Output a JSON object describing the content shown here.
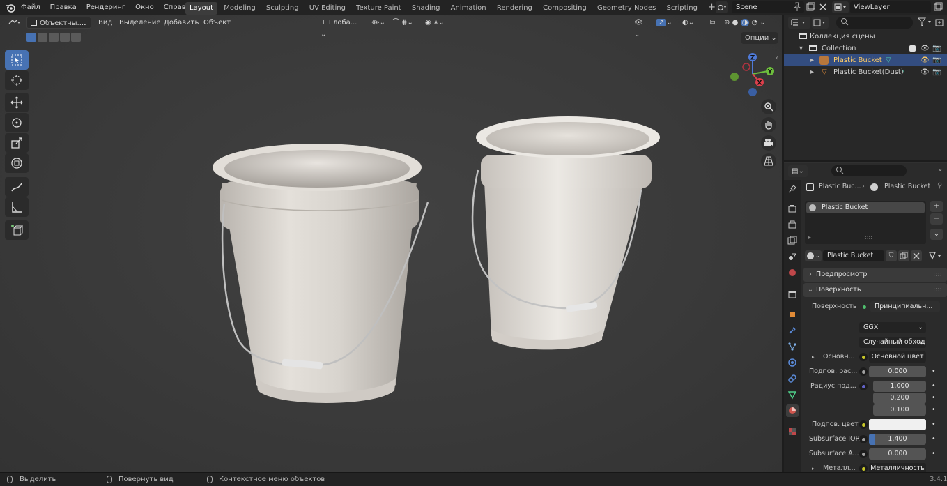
{
  "menu": [
    "Файл",
    "Правка",
    "Рендеринг",
    "Окно",
    "Справка"
  ],
  "workspaces": [
    "Layout",
    "Modeling",
    "Sculpting",
    "UV Editing",
    "Texture Paint",
    "Shading",
    "Animation",
    "Rendering",
    "Compositing",
    "Geometry Nodes",
    "Scripting"
  ],
  "active_workspace": "Layout",
  "scene_name": "Scene",
  "view_layer": "ViewLayer",
  "viewport": {
    "mode": "Объектны...",
    "menus": [
      "Вид",
      "Выделение",
      "Добавить",
      "Объект"
    ],
    "transform_orientation": "Глоба...",
    "options": "Опции",
    "gizmo_axes": {
      "x": "X",
      "y": "Y",
      "z": "Z"
    }
  },
  "outliner": {
    "root": "Коллекция сцены",
    "collection": "Collection",
    "items": [
      "Plastic Bucket",
      "Plastic Bucket(Dust)"
    ]
  },
  "properties": {
    "breadcrumb_object": "Plastic Buc...",
    "breadcrumb_material": "Plastic Bucket",
    "slot": "Plastic Bucket",
    "material_name": "Plastic Bucket",
    "panel_preview": "Предпросмотр",
    "panel_surface": "Поверхность",
    "surface_label": "Поверхность",
    "surface_value": "Принципиальн...",
    "distribution": "GGX",
    "subsurface_method": "Случайный обход",
    "base_color_label": "Основн...",
    "base_color_value": "Основной цвет",
    "subsurface_label": "Подпов. рас...",
    "subsurface_value": "0.000",
    "radius_label": "Радиус под...",
    "radius_values": [
      "1.000",
      "0.200",
      "0.100"
    ],
    "subsurface_color_label": "Подпов. цвет",
    "ior_label": "Subsurface IOR",
    "ior_value": "1.400",
    "aniso_label": "Subsurface A...",
    "aniso_value": "0.000",
    "metallic_label": "Металл...",
    "metallic_value": "Металличность"
  },
  "status": {
    "select": "Выделить",
    "rotate": "Повернуть вид",
    "context": "Контекстное меню объектов",
    "version": "3.4.1"
  },
  "colors": {
    "accent": "#4772b3",
    "selected_text": "#ffcc66",
    "bucket": "#ddd8d2"
  }
}
